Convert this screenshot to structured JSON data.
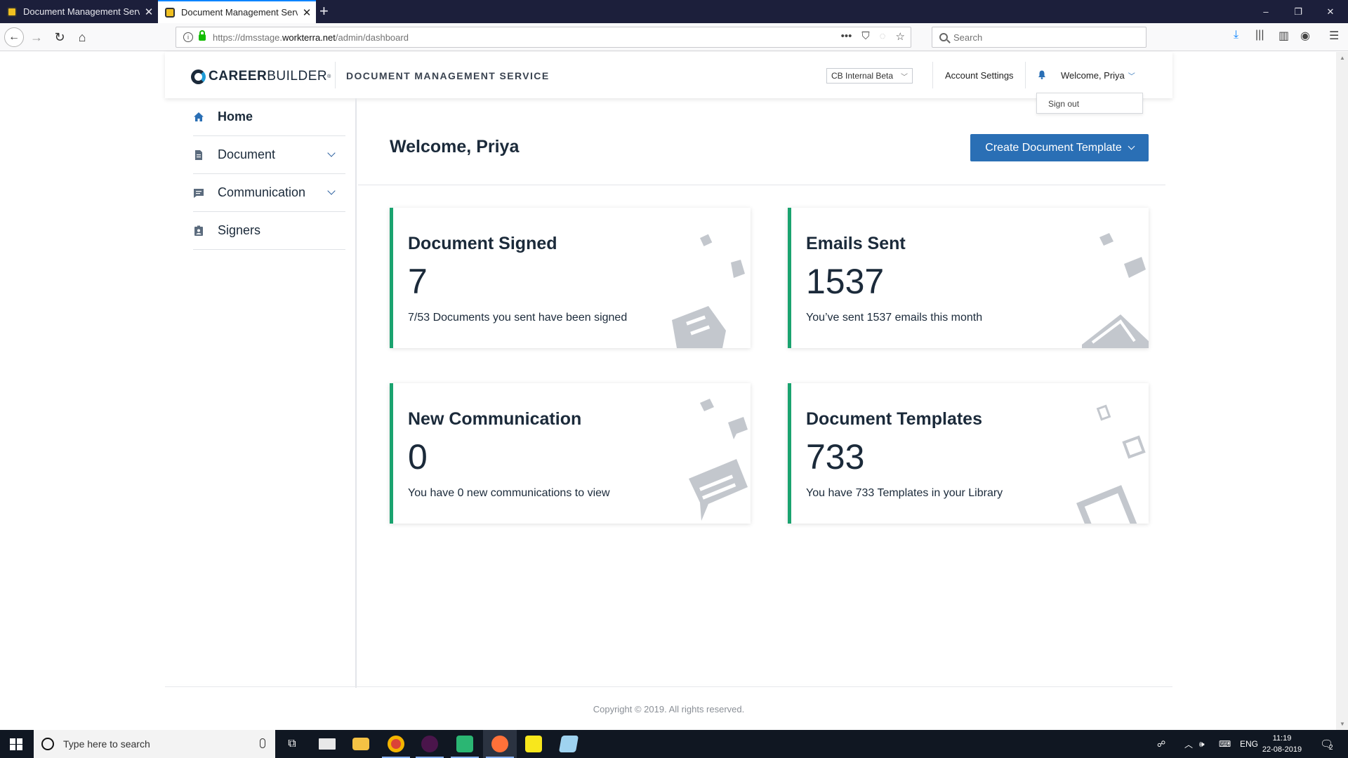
{
  "browser": {
    "tabs": [
      {
        "label": "Document Management Servic",
        "active": false
      },
      {
        "label": "Document Management Servic",
        "active": true
      }
    ],
    "new_tab": "+",
    "url_prefix": "https://dmsstage.",
    "url_domain": "workterra.net",
    "url_path": "/admin/dashboard",
    "url_actions": "•••",
    "search_placeholder": "Search",
    "window_controls": {
      "minimize": "–",
      "restore": "❐",
      "close": "✕"
    }
  },
  "header": {
    "logo_bold": "CAREER",
    "logo_light": "BUILDER",
    "logo_tm": "®",
    "app_title": "DOCUMENT MANAGEMENT SERVICE",
    "tenant_select": "CB Internal Beta",
    "account_settings": "Account Settings",
    "welcome_menu": "Welcome, Priya",
    "dropdown_item": "Sign out"
  },
  "sidebar": {
    "items": [
      {
        "label": "Home",
        "icon": "home-icon",
        "active": true
      },
      {
        "label": "Document",
        "icon": "document-icon",
        "expandable": true
      },
      {
        "label": "Communication",
        "icon": "chat-icon",
        "expandable": true
      },
      {
        "label": "Signers",
        "icon": "id-badge-icon"
      }
    ]
  },
  "main": {
    "title": "Welcome, Priya",
    "create_button": "Create Document Template",
    "cards": [
      {
        "title": "Document Signed",
        "value": "7",
        "desc": "7/53 Documents you sent have been signed",
        "icon": "signed-document-icon"
      },
      {
        "title": "Emails Sent",
        "value": "1537",
        "desc": "You’ve sent 1537 emails this month",
        "icon": "envelope-icon"
      },
      {
        "title": "New Communication",
        "value": "0",
        "desc": "You have 0 new communications to view",
        "icon": "message-icon"
      },
      {
        "title": "Document Templates",
        "value": "733",
        "desc": "You have 733 Templates in your Library",
        "icon": "template-icon"
      }
    ],
    "accent_color": "#1aa36f",
    "button_color": "#2a6fb5"
  },
  "footer": {
    "copyright": "Copyright © 2019. All rights reserved."
  },
  "taskbar": {
    "search_placeholder": "Type here to search",
    "lang": "ENG",
    "time": "11:19",
    "date": "22-08-2019",
    "notifications": "2"
  }
}
